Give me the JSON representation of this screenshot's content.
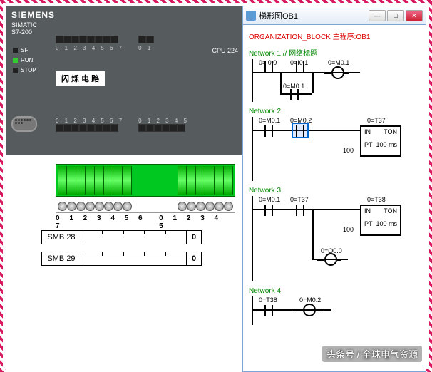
{
  "plc": {
    "brand": "SIEMENS",
    "model": "SIMATIC\nS7-200",
    "cpu": "CPU 224",
    "leds": [
      {
        "name": "SF",
        "on": false
      },
      {
        "name": "RUN",
        "on": true
      },
      {
        "name": "STOP",
        "on": false
      }
    ],
    "inputs_a": "0 1 2 3 4 5 6 7",
    "inputs_b": "0 1",
    "outputs_a": "0 1 2 3 4 5 6 7",
    "outputs_b": "0 1 2 3 4 5",
    "display": "闪 烁 电 路"
  },
  "terminal": {
    "nums_a": "0 1 2 3 4 5 6 7",
    "nums_b": "0 1 2 3 4 5"
  },
  "smb": [
    {
      "label": "SMB 28",
      "value": "0"
    },
    {
      "label": "SMB 29",
      "value": "0"
    }
  ],
  "window": {
    "title": "梯形图OB1",
    "ob": "ORGANIZATION_BLOCK 主程序:OB1",
    "networks": [
      {
        "label": "Network 1 // 网络标题",
        "elems": {
          "c1": "0=I0.0",
          "c2": "0=I0.1",
          "o1": "0=M0.1",
          "c3": "0=M0.1"
        }
      },
      {
        "label": "Network 2",
        "elems": {
          "c1": "0=M0.1",
          "c2": "0=M0.2",
          "t": "0=T37",
          "in": "IN",
          "ton": "TON",
          "ptv": "100",
          "pt": "PT",
          "ms": "100 ms"
        }
      },
      {
        "label": "Network 3",
        "elems": {
          "c1": "0=M0.1",
          "c2": "0=T37",
          "t": "0=T38",
          "in": "IN",
          "ton": "TON",
          "ptv": "100",
          "pt": "PT",
          "ms": "100 ms",
          "q": "0=Q0.0"
        }
      },
      {
        "label": "Network 4",
        "elems": {
          "c1": "0=T38",
          "o1": "0=M0.2"
        }
      }
    ]
  },
  "watermark": "头条号 / 全球电气资源"
}
